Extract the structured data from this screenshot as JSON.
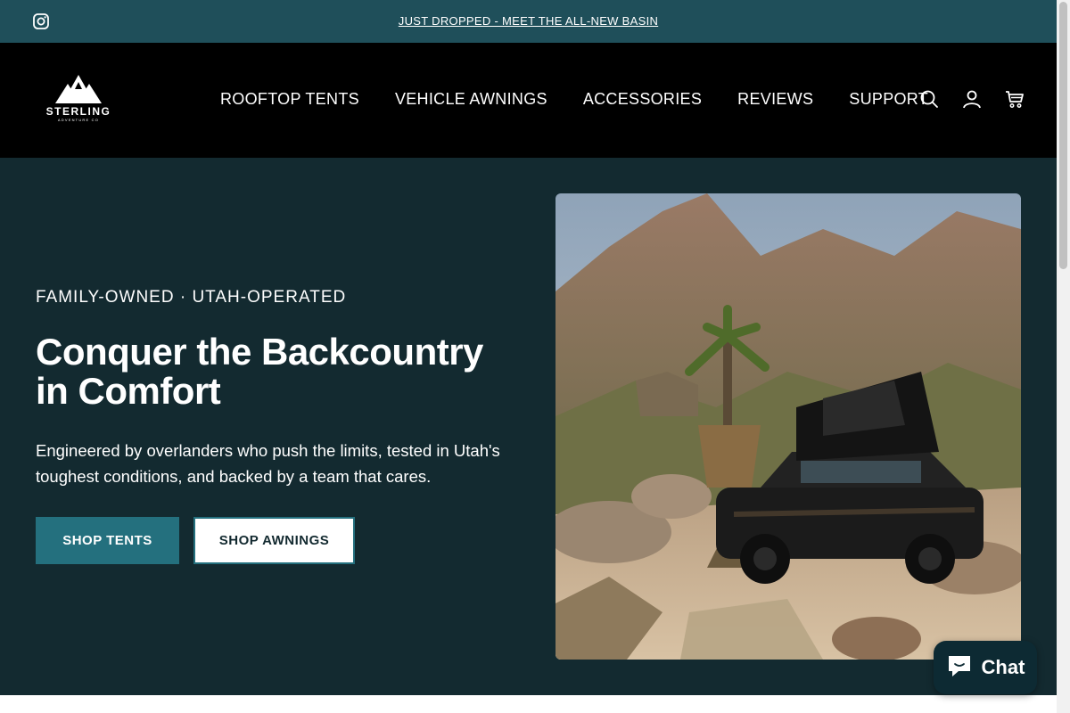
{
  "announcement": {
    "text": "JUST DROPPED - MEET THE ALL-NEW BASIN",
    "social_icon": "instagram-icon"
  },
  "header": {
    "logo": {
      "name": "STERLING",
      "tagline": "ADVENTURE CO"
    },
    "nav": [
      {
        "label": "ROOFTOP TENTS"
      },
      {
        "label": "VEHICLE AWNINGS"
      },
      {
        "label": "ACCESSORIES"
      },
      {
        "label": "REVIEWS"
      },
      {
        "label": "SUPPORT"
      }
    ],
    "icons": [
      "search-icon",
      "account-icon",
      "cart-icon"
    ]
  },
  "hero": {
    "eyebrow": "FAMILY-OWNED · UTAH-OPERATED",
    "headline": "Conquer the Backcountry in Comfort",
    "subcopy": "Engineered by overlanders who push the limits, tested in Utah's toughest conditions, and backed by a team that cares.",
    "primary_button": "SHOP TENTS",
    "secondary_button": "SHOP AWNINGS"
  },
  "chat": {
    "label": "Chat",
    "icon": "chat-bubble-icon"
  },
  "colors": {
    "announcement_bg": "#1f4f5a",
    "header_bg": "#000000",
    "hero_bg": "#132a30",
    "accent": "#24707e",
    "chat_bg": "#0d2a33"
  }
}
